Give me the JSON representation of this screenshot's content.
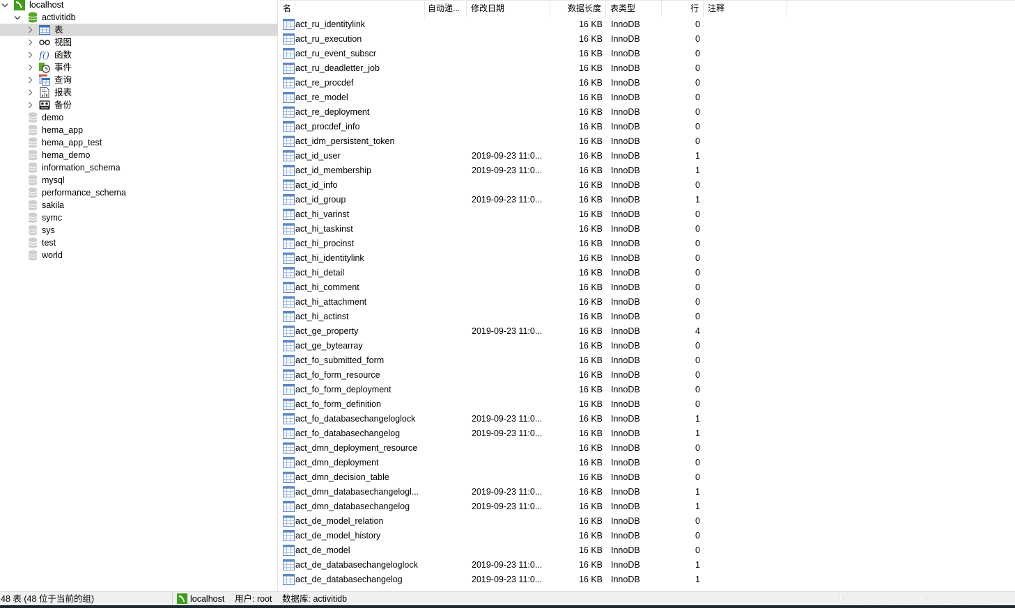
{
  "sidebar": {
    "connection": {
      "label": "localhost",
      "icon": "mysql-connection-icon"
    },
    "database": {
      "label": "activitidb",
      "icon": "database-open-icon"
    },
    "object_groups": [
      {
        "label": "表",
        "icon": "table-grid-icon",
        "selected": true
      },
      {
        "label": "视图",
        "icon": "glasses-view-icon"
      },
      {
        "label": "函数",
        "icon": "function-fx-icon"
      },
      {
        "label": "事件",
        "icon": "event-clock-icon"
      },
      {
        "label": "查询",
        "icon": "query-icon"
      },
      {
        "label": "报表",
        "icon": "report-icon"
      },
      {
        "label": "备份",
        "icon": "backup-icon"
      }
    ],
    "other_databases": [
      "demo",
      "hema_app",
      "hema_app_test",
      "hema_demo",
      "information_schema",
      "mysql",
      "performance_schema",
      "sakila",
      "symc",
      "sys",
      "test",
      "world"
    ]
  },
  "table": {
    "columns": {
      "name": "名",
      "auto_increment": "自动递...",
      "modified": "修改日期",
      "data_length": "数据长度",
      "engine": "表类型",
      "rows": "行",
      "comment": "注释"
    },
    "rows": [
      {
        "name": "act_ru_identitylink",
        "modified": "",
        "size": "16 KB",
        "engine": "InnoDB",
        "rows": "0"
      },
      {
        "name": "act_ru_execution",
        "modified": "",
        "size": "16 KB",
        "engine": "InnoDB",
        "rows": "0"
      },
      {
        "name": "act_ru_event_subscr",
        "modified": "",
        "size": "16 KB",
        "engine": "InnoDB",
        "rows": "0"
      },
      {
        "name": "act_ru_deadletter_job",
        "modified": "",
        "size": "16 KB",
        "engine": "InnoDB",
        "rows": "0"
      },
      {
        "name": "act_re_procdef",
        "modified": "",
        "size": "16 KB",
        "engine": "InnoDB",
        "rows": "0"
      },
      {
        "name": "act_re_model",
        "modified": "",
        "size": "16 KB",
        "engine": "InnoDB",
        "rows": "0"
      },
      {
        "name": "act_re_deployment",
        "modified": "",
        "size": "16 KB",
        "engine": "InnoDB",
        "rows": "0"
      },
      {
        "name": "act_procdef_info",
        "modified": "",
        "size": "16 KB",
        "engine": "InnoDB",
        "rows": "0"
      },
      {
        "name": "act_idm_persistent_token",
        "modified": "",
        "size": "16 KB",
        "engine": "InnoDB",
        "rows": "0"
      },
      {
        "name": "act_id_user",
        "modified": "2019-09-23 11:0...",
        "size": "16 KB",
        "engine": "InnoDB",
        "rows": "1"
      },
      {
        "name": "act_id_membership",
        "modified": "2019-09-23 11:0...",
        "size": "16 KB",
        "engine": "InnoDB",
        "rows": "1"
      },
      {
        "name": "act_id_info",
        "modified": "",
        "size": "16 KB",
        "engine": "InnoDB",
        "rows": "0"
      },
      {
        "name": "act_id_group",
        "modified": "2019-09-23 11:0...",
        "size": "16 KB",
        "engine": "InnoDB",
        "rows": "1"
      },
      {
        "name": "act_hi_varinst",
        "modified": "",
        "size": "16 KB",
        "engine": "InnoDB",
        "rows": "0"
      },
      {
        "name": "act_hi_taskinst",
        "modified": "",
        "size": "16 KB",
        "engine": "InnoDB",
        "rows": "0"
      },
      {
        "name": "act_hi_procinst",
        "modified": "",
        "size": "16 KB",
        "engine": "InnoDB",
        "rows": "0"
      },
      {
        "name": "act_hi_identitylink",
        "modified": "",
        "size": "16 KB",
        "engine": "InnoDB",
        "rows": "0"
      },
      {
        "name": "act_hi_detail",
        "modified": "",
        "size": "16 KB",
        "engine": "InnoDB",
        "rows": "0"
      },
      {
        "name": "act_hi_comment",
        "modified": "",
        "size": "16 KB",
        "engine": "InnoDB",
        "rows": "0"
      },
      {
        "name": "act_hi_attachment",
        "modified": "",
        "size": "16 KB",
        "engine": "InnoDB",
        "rows": "0"
      },
      {
        "name": "act_hi_actinst",
        "modified": "",
        "size": "16 KB",
        "engine": "InnoDB",
        "rows": "0"
      },
      {
        "name": "act_ge_property",
        "modified": "2019-09-23 11:0...",
        "size": "16 KB",
        "engine": "InnoDB",
        "rows": "4"
      },
      {
        "name": "act_ge_bytearray",
        "modified": "",
        "size": "16 KB",
        "engine": "InnoDB",
        "rows": "0"
      },
      {
        "name": "act_fo_submitted_form",
        "modified": "",
        "size": "16 KB",
        "engine": "InnoDB",
        "rows": "0"
      },
      {
        "name": "act_fo_form_resource",
        "modified": "",
        "size": "16 KB",
        "engine": "InnoDB",
        "rows": "0"
      },
      {
        "name": "act_fo_form_deployment",
        "modified": "",
        "size": "16 KB",
        "engine": "InnoDB",
        "rows": "0"
      },
      {
        "name": "act_fo_form_definition",
        "modified": "",
        "size": "16 KB",
        "engine": "InnoDB",
        "rows": "0"
      },
      {
        "name": "act_fo_databasechangeloglock",
        "modified": "2019-09-23 11:0...",
        "size": "16 KB",
        "engine": "InnoDB",
        "rows": "1"
      },
      {
        "name": "act_fo_databasechangelog",
        "modified": "2019-09-23 11:0...",
        "size": "16 KB",
        "engine": "InnoDB",
        "rows": "1"
      },
      {
        "name": "act_dmn_deployment_resource",
        "modified": "",
        "size": "16 KB",
        "engine": "InnoDB",
        "rows": "0"
      },
      {
        "name": "act_dmn_deployment",
        "modified": "",
        "size": "16 KB",
        "engine": "InnoDB",
        "rows": "0"
      },
      {
        "name": "act_dmn_decision_table",
        "modified": "",
        "size": "16 KB",
        "engine": "InnoDB",
        "rows": "0"
      },
      {
        "name": "act_dmn_databasechangelogl...",
        "modified": "2019-09-23 11:0...",
        "size": "16 KB",
        "engine": "InnoDB",
        "rows": "1"
      },
      {
        "name": "act_dmn_databasechangelog",
        "modified": "2019-09-23 11:0...",
        "size": "16 KB",
        "engine": "InnoDB",
        "rows": "1"
      },
      {
        "name": "act_de_model_relation",
        "modified": "",
        "size": "16 KB",
        "engine": "InnoDB",
        "rows": "0"
      },
      {
        "name": "act_de_model_history",
        "modified": "",
        "size": "16 KB",
        "engine": "InnoDB",
        "rows": "0"
      },
      {
        "name": "act_de_model",
        "modified": "",
        "size": "16 KB",
        "engine": "InnoDB",
        "rows": "0"
      },
      {
        "name": "act_de_databasechangeloglock",
        "modified": "2019-09-23 11:0...",
        "size": "16 KB",
        "engine": "InnoDB",
        "rows": "1"
      },
      {
        "name": "act_de_databasechangelog",
        "modified": "2019-09-23 11:0...",
        "size": "16 KB",
        "engine": "InnoDB",
        "rows": "1"
      }
    ]
  },
  "statusbar": {
    "table_count": "48 表 (48 位于当前的组)",
    "connection": "localhost",
    "user": "用户: root",
    "database": "数据库: activitidb",
    "watermark": "https://blog.csdn.net/qq_33333654"
  },
  "colors": {
    "mysql_green": "#3f9c1d",
    "db_green": "#5aa62b",
    "table_icon_blue": "#3a73b8",
    "selection_gray": "#dadada",
    "statusbar_bg": "#f0f0f0"
  }
}
